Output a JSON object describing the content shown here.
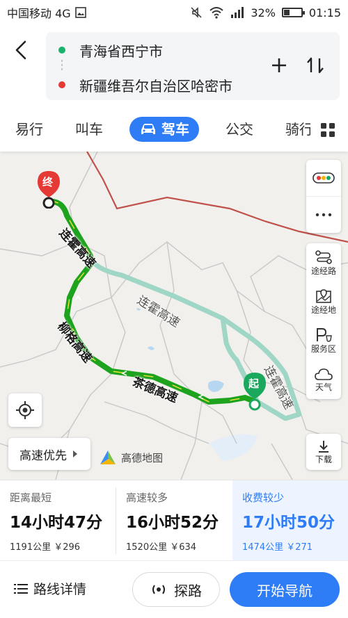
{
  "status_bar": {
    "carrier": "中国移动 4G",
    "battery": "32%",
    "battery_level": 0.32,
    "time": "01:15"
  },
  "route": {
    "origin": "青海省西宁市",
    "destination": "新疆维吾尔自治区哈密市"
  },
  "tabs": [
    {
      "label": "易行"
    },
    {
      "label": "叫车"
    },
    {
      "label": "驾车",
      "active": true
    },
    {
      "label": "公交"
    },
    {
      "label": "骑行"
    }
  ],
  "map": {
    "end_marker": "终",
    "start_marker": "起",
    "road_labels": [
      "连霍高速",
      "连霍高速",
      "柳格高速",
      "茶德高速",
      "连霍高速"
    ],
    "side_buttons": [
      {
        "icon": "traffic-light-icon",
        "label": ""
      },
      {
        "icon": "more-icon",
        "label": ""
      },
      {
        "icon": "waypoint-route-icon",
        "label": "途经路"
      },
      {
        "icon": "waypoint-place-icon",
        "label": "途经地"
      },
      {
        "icon": "service-area-icon",
        "label": "服务区"
      },
      {
        "icon": "weather-icon",
        "label": "天气"
      }
    ],
    "download_label": "下载",
    "preference_label": "高速优先",
    "logo_text": "高德地图"
  },
  "route_options": [
    {
      "tag": "距离最短",
      "time": "14小时47分",
      "distance": "1191公里",
      "toll": "￥296",
      "selected": false
    },
    {
      "tag": "高速较多",
      "time": "16小时52分",
      "distance": "1520公里",
      "toll": "￥634",
      "selected": false
    },
    {
      "tag": "收费较少",
      "time": "17小时50分",
      "distance": "1474公里",
      "toll": "￥271",
      "selected": true
    }
  ],
  "bottom": {
    "details_label": "路线详情",
    "explore_label": "探路",
    "navigate_label": "开始导航"
  },
  "colors": {
    "accent": "#2e7cf6",
    "route_main": "#1ea31e",
    "route_alt": "#9fd6c5",
    "border_line": "#c0514b",
    "origin_dot": "#19b36b",
    "destination_dot": "#e53935"
  }
}
